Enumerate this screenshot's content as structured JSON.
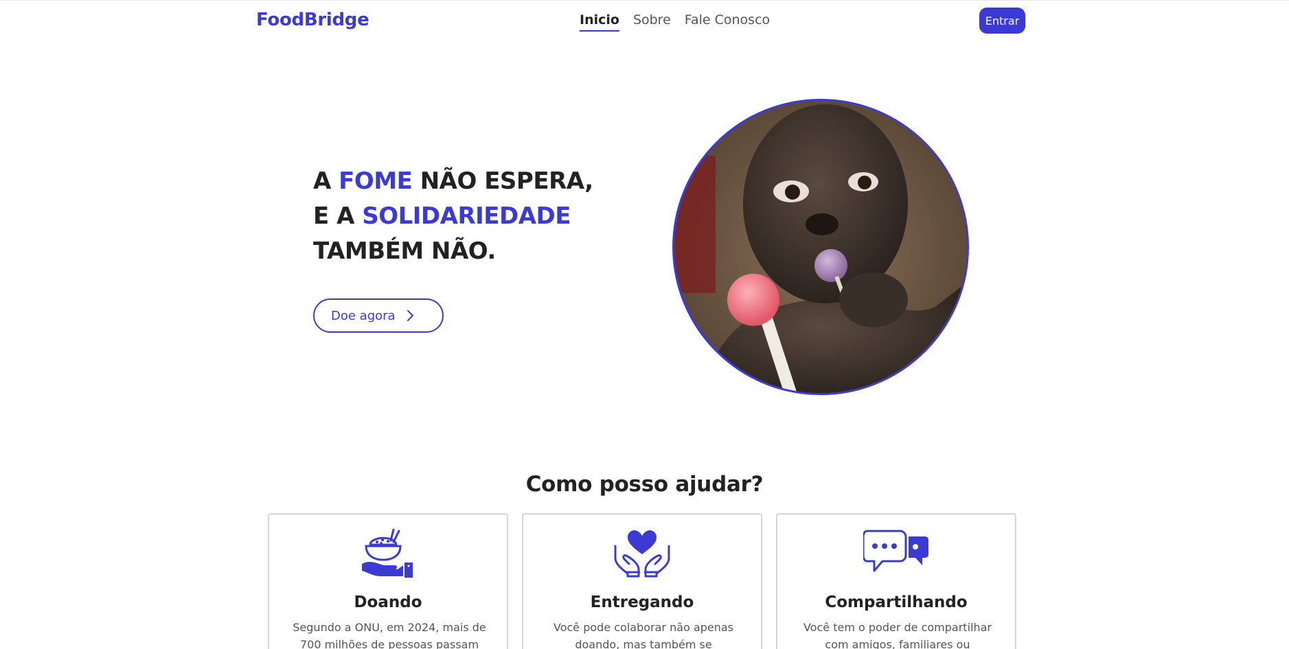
{
  "header": {
    "logo": "FoodBridge",
    "nav": [
      {
        "label": "Inicio",
        "active": true
      },
      {
        "label": "Sobre",
        "active": false
      },
      {
        "label": "Fale Conosco",
        "active": false
      }
    ],
    "login_label": "Entrar"
  },
  "hero": {
    "title_line1_a": "A ",
    "title_line1_hl": "FOME",
    "title_line1_b": " NÃO ESPERA,",
    "title_line2_a": "E A ",
    "title_line2_hl": "SOLIDARIEDADE",
    "title_line3": "TAMBÉM NÃO.",
    "cta_label": "Doe agora"
  },
  "help": {
    "title": "Como posso ajudar?",
    "cards": [
      {
        "title": "Doando",
        "text": "Segundo a ONU, em 2024, mais de 700 milhões de pessoas passam",
        "icon": "donation-bowl-icon"
      },
      {
        "title": "Entregando",
        "text": "Você pode colaborar não apenas doando, mas também se",
        "icon": "heart-hands-icon"
      },
      {
        "title": "Compartilhando",
        "text": "Você tem o poder de compartilhar com amigos, familiares ou",
        "icon": "chat-bubbles-icon"
      }
    ]
  },
  "colors": {
    "accent": "#3b3bd4",
    "text": "#222222",
    "muted": "#555555"
  }
}
